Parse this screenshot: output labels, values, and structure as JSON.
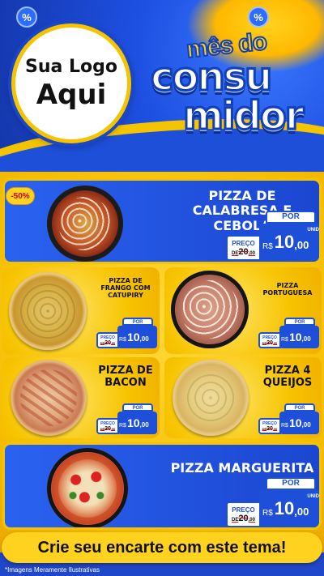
{
  "header": {
    "logo_line1": "Sua Logo",
    "logo_line2": "Aqui",
    "title_top": "mês do",
    "title_mid": "consu",
    "title_bot": "midor",
    "percent_symbol": "%"
  },
  "colors": {
    "brand_blue": "#1d4fd8",
    "accent_yellow": "#ffd21f",
    "strike_red": "#e00000"
  },
  "discount_badge": "-50%",
  "price_labels": {
    "preco": "PREÇO",
    "de": "DE",
    "por": "POR",
    "currency": "R$",
    "unid": "UNID"
  },
  "products": [
    {
      "name": "PIZZA DE CALABRESA E CEBOLA",
      "old_price": "20",
      "old_cents": ",00",
      "new_price": "10",
      "new_cents": ",00"
    },
    {
      "name": "PIZZA DE FRANGO COM CATUPIRY",
      "old_price": "20",
      "old_cents": ",00",
      "new_price": "10",
      "new_cents": ",00"
    },
    {
      "name": "PIZZA PORTUGUESA",
      "old_price": "20",
      "old_cents": ",00",
      "new_price": "10",
      "new_cents": ",00"
    },
    {
      "name": "PIZZA DE BACON",
      "old_price": "20",
      "old_cents": ",00",
      "new_price": "10",
      "new_cents": ",00"
    },
    {
      "name": "PIZZA 4 QUEIJOS",
      "old_price": "20",
      "old_cents": ",00",
      "new_price": "10",
      "new_cents": ",00"
    },
    {
      "name": "PIZZA MARGUERITA",
      "old_price": "20",
      "old_cents": ",00",
      "new_price": "10",
      "new_cents": ",00"
    }
  ],
  "footer": {
    "cta": "Crie seu encarte com este tema!",
    "disclaimer": "*Imagens Meramente Ilustrativas"
  }
}
